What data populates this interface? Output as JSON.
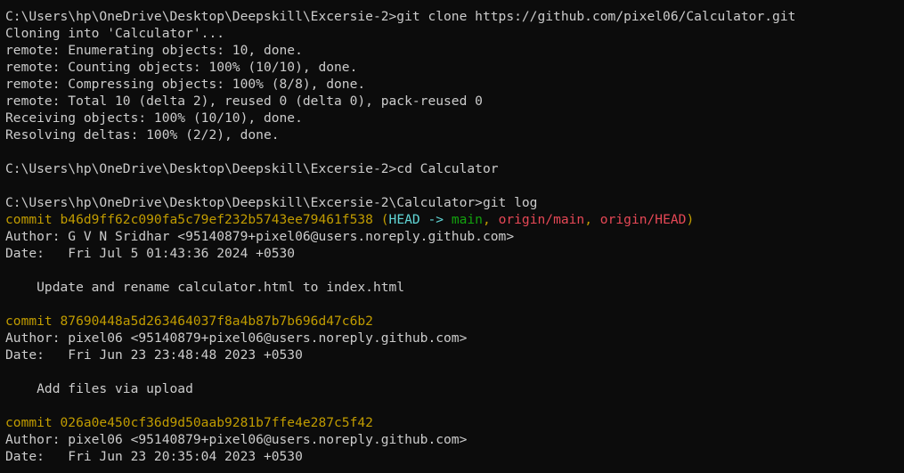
{
  "terminal": {
    "clone_prompt": "C:\\Users\\hp\\OneDrive\\Desktop\\Deepskill\\Excersie-2>git clone https://github.com/pixel06/Calculator.git",
    "cloning": "Cloning into 'Calculator'...",
    "enum": "remote: Enumerating objects: 10, done.",
    "counting": "remote: Counting objects: 100% (10/10), done.",
    "compressing": "remote: Compressing objects: 100% (8/8), done.",
    "total": "remote: Total 10 (delta 2), reused 0 (delta 0), pack-reused 0",
    "receiving": "Receiving objects: 100% (10/10), done.",
    "resolving": "Resolving deltas: 100% (2/2), done.",
    "cd_prompt": "C:\\Users\\hp\\OneDrive\\Desktop\\Deepskill\\Excersie-2>cd Calculator",
    "log_prompt": "C:\\Users\\hp\\OneDrive\\Desktop\\Deepskill\\Excersie-2\\Calculator>git log"
  },
  "commits": [
    {
      "commit_prefix": "commit b46d9ff62c090fa5c79ef232b5743ee79461f538",
      "refs_open": " (",
      "head": "HEAD -> ",
      "main": "main",
      "sep1": ", ",
      "origin_main": "origin/main",
      "sep2": ", ",
      "origin_head": "origin/HEAD",
      "refs_close": ")",
      "author": "Author: G V N Sridhar <95140879+pixel06@users.noreply.github.com>",
      "date": "Date:   Fri Jul 5 01:43:36 2024 +0530",
      "message": "    Update and rename calculator.html to index.html"
    },
    {
      "commit_prefix": "commit 87690448a5d263464037f8a4b87b7b696d47c6b2",
      "author": "Author: pixel06 <95140879+pixel06@users.noreply.github.com>",
      "date": "Date:   Fri Jun 23 23:48:48 2023 +0530",
      "message": "    Add files via upload"
    },
    {
      "commit_prefix": "commit 026a0e450cf36d9d50aab9281b7ffe4e287c5f42",
      "author": "Author: pixel06 <95140879+pixel06@users.noreply.github.com>",
      "date": "Date:   Fri Jun 23 20:35:04 2023 +0530"
    }
  ],
  "colors": {
    "background": "#0c0c0c",
    "foreground": "#cccccc",
    "commit": "#c19c00",
    "head": "#61d6d6",
    "branch": "#13a10e",
    "remote": "#e74856"
  }
}
